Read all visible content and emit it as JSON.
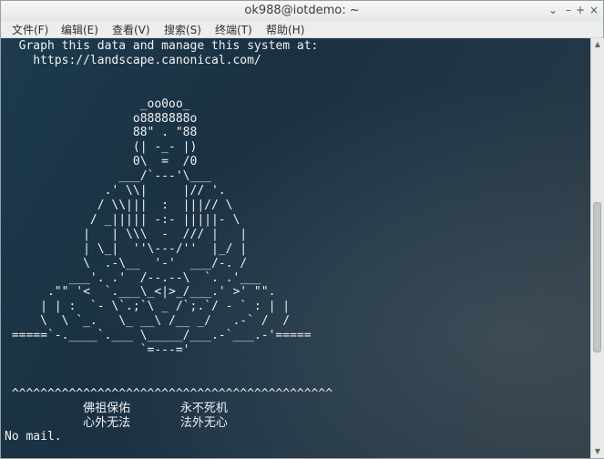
{
  "window": {
    "title": "ok988@iotdemo: ~",
    "controls": {
      "close": "×",
      "minimize": "–",
      "maximize": "+",
      "roll": "⌄"
    }
  },
  "menu": {
    "items": [
      {
        "label": "文件(F)"
      },
      {
        "label": "编辑(E)"
      },
      {
        "label": "查看(V)"
      },
      {
        "label": "搜索(S)"
      },
      {
        "label": "终端(T)"
      },
      {
        "label": "帮助(H)"
      }
    ]
  },
  "terminal": {
    "lines": [
      "  Graph this data and manage this system at:",
      "    https://landscape.canonical.com/",
      "",
      "",
      "                   _oo0oo_",
      "                  o8888888o",
      "                  88\" . \"88",
      "                  (| -_- |)",
      "                  0\\  =  /0",
      "                ___/`---'\\___",
      "              .' \\\\|     |// '.",
      "             / \\\\|||  :  |||// \\",
      "            / _||||| -:- |||||- \\",
      "           |   | \\\\\\  -  /// |   |",
      "           | \\_|  ''\\---/''  |_/ |",
      "           \\  .-\\__  '-'  ___/-. /",
      "         ___'. .'  /--.--\\  `. .'___",
      "      .\"\" '<  `.___\\_<|>_/___.' >' \"\".",
      "     | | :  `- \\`.;`\\ _ /`;.`/ - ` : | |",
      "     \\  \\ `_.   \\_ __\\ /__ _/   .-` /  /",
      " =====`-.____`.___ \\_____/___.-`___.-'=====",
      "                   `=---='",
      "",
      "",
      " ^^^^^^^^^^^^^^^^^^^^^^^^^^^^^^^^^^^^^^^^^^^^^",
      "           佛祖保佑       永不死机",
      "           心外无法       法外无心",
      "No mail."
    ]
  },
  "scrollbar": {
    "up": "▲",
    "down": "▼",
    "position": 0.62,
    "visible_fraction": 0.38
  }
}
